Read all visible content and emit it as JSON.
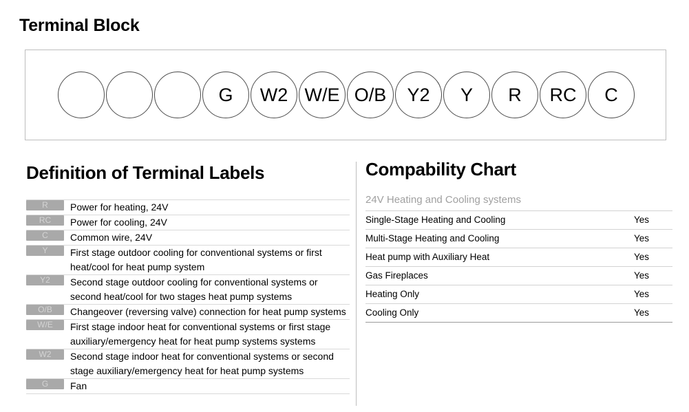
{
  "page_title": "Terminal Block",
  "terminal_block": {
    "terminals": [
      {
        "label": "",
        "name": "terminal-circle-blank-1"
      },
      {
        "label": "",
        "name": "terminal-circle-blank-2"
      },
      {
        "label": "",
        "name": "terminal-circle-blank-3"
      },
      {
        "label": "G",
        "name": "terminal-circle-g"
      },
      {
        "label": "W2",
        "name": "terminal-circle-w2"
      },
      {
        "label": "W/E",
        "name": "terminal-circle-we"
      },
      {
        "label": "O/B",
        "name": "terminal-circle-ob"
      },
      {
        "label": "Y2",
        "name": "terminal-circle-y2"
      },
      {
        "label": "Y",
        "name": "terminal-circle-y"
      },
      {
        "label": "R",
        "name": "terminal-circle-r"
      },
      {
        "label": "RC",
        "name": "terminal-circle-rc"
      },
      {
        "label": "C",
        "name": "terminal-circle-c"
      }
    ]
  },
  "definitions": {
    "heading": "Definition of Terminal Labels",
    "rows": [
      {
        "badge": "R",
        "text": "Power for heating, 24V"
      },
      {
        "badge": "RC",
        "text": "Power for cooling, 24V"
      },
      {
        "badge": "C",
        "text": "Common wire, 24V"
      },
      {
        "badge": "Y",
        "text": "First stage outdoor cooling for conventional systems or first heat/cool for heat pump system"
      },
      {
        "badge": "Y2",
        "text": "Second stage outdoor cooling for conventional systems or second heat/cool for two stages heat pump systems"
      },
      {
        "badge": "O/B",
        "text": "Changeover (reversing valve) connection for heat pump systems"
      },
      {
        "badge": "W/E",
        "text": "First stage indoor heat for conventional systems or first stage auxiliary/emergency heat for heat pump systems systems"
      },
      {
        "badge": "W2",
        "text": "Second stage indoor heat for conventional systems or second stage auxiliary/emergency heat for heat pump systems"
      },
      {
        "badge": "G",
        "text": "Fan"
      }
    ]
  },
  "compatibility": {
    "heading": "Compability Chart",
    "subheading": "24V Heating and Cooling systems",
    "rows": [
      {
        "system": "Single-Stage Heating and Cooling",
        "value": "Yes"
      },
      {
        "system": "Multi-Stage Heating and Cooling",
        "value": "Yes"
      },
      {
        "system": "Heat pump with Auxiliary Heat",
        "value": "Yes"
      },
      {
        "system": "Gas Fireplaces",
        "value": "Yes"
      },
      {
        "system": "Heating Only",
        "value": "Yes"
      },
      {
        "system": "Cooling  Only",
        "value": "Yes"
      }
    ]
  },
  "colors": {
    "badge_background": "#a9a9a9",
    "badge_text": "#d4d4d4",
    "block_border": "#bdbdbd",
    "circle_stroke": "#4a4a4a",
    "subheading_text": "#a0a0a0",
    "row_divider": "#d9d9d9"
  }
}
